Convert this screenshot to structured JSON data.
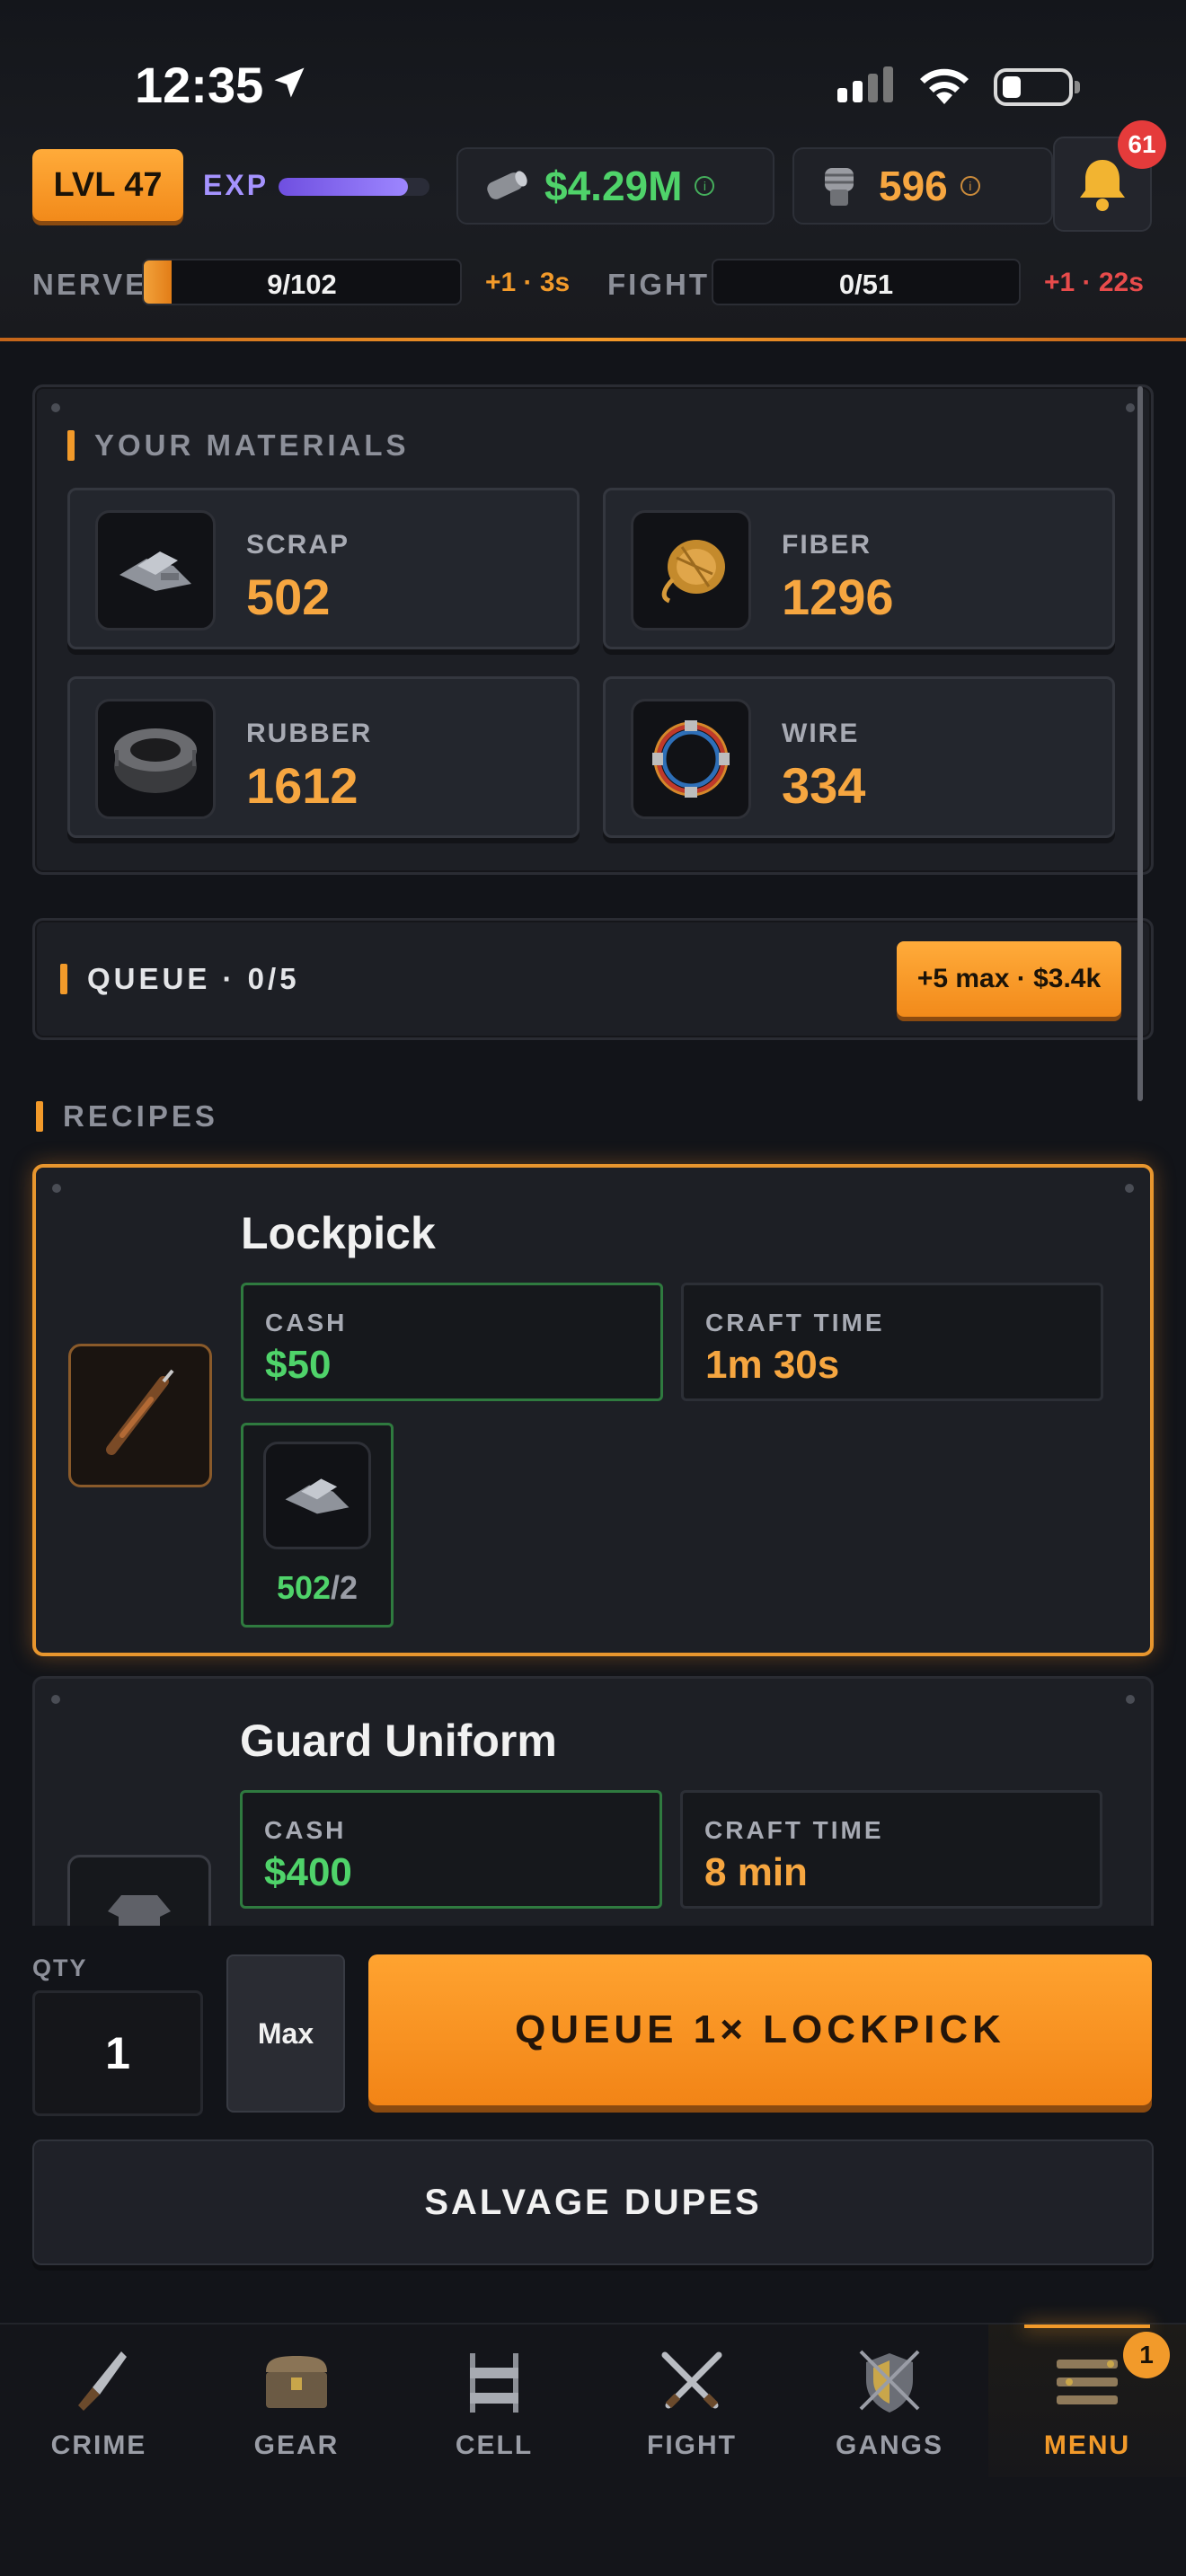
{
  "status": {
    "time": "12:35"
  },
  "header": {
    "level": "LVL 47",
    "exp_label": "EXP",
    "exp_fraction": 0.86,
    "cash": "$4.29M",
    "fist": "596",
    "notifications": "61",
    "nerve": {
      "label": "NERVE",
      "value": "9/102",
      "fraction": 0.088,
      "regen": "+1 · 3s"
    },
    "fight": {
      "label": "FIGHT",
      "value": "0/51",
      "fraction": 0,
      "regen": "+1 · 22s"
    }
  },
  "materials": {
    "title": "YOUR MATERIALS",
    "items": [
      {
        "name": "SCRAP",
        "value": "502"
      },
      {
        "name": "FIBER",
        "value": "1296"
      },
      {
        "name": "RUBBER",
        "value": "1612"
      },
      {
        "name": "WIRE",
        "value": "334"
      }
    ]
  },
  "queue": {
    "label": "QUEUE · 0/5",
    "button": "+5 max · $3.4k"
  },
  "recipes": {
    "title": "RECIPES",
    "items": [
      {
        "name": "Lockpick",
        "cash_label": "CASH",
        "cash": "$50",
        "time_label": "CRAFT TIME",
        "time": "1m 30s",
        "req_have": "502",
        "req_need": "/2"
      },
      {
        "name": "Guard Uniform",
        "cash_label": "CASH",
        "cash": "$400",
        "time_label": "CRAFT TIME",
        "time": "8 min"
      }
    ]
  },
  "controls": {
    "qty_label": "QTY",
    "qty_value": "1",
    "max_label": "Max",
    "queue_action": "QUEUE 1× LOCKPICK",
    "salvage": "SALVAGE DUPES"
  },
  "tabs": [
    {
      "label": "CRIME",
      "icon": "knife-icon"
    },
    {
      "label": "GEAR",
      "icon": "chest-icon"
    },
    {
      "label": "CELL",
      "icon": "bunk-icon"
    },
    {
      "label": "FIGHT",
      "icon": "crossed-swords-icon"
    },
    {
      "label": "GANGS",
      "icon": "shield-icon"
    },
    {
      "label": "MENU",
      "icon": "menu-icon",
      "badge": "1",
      "active": true
    }
  ],
  "colors": {
    "accent": "#f29a2a",
    "cash_green": "#4fd36a",
    "danger": "#e53b3b",
    "exp_purple": "#9d86ff"
  }
}
